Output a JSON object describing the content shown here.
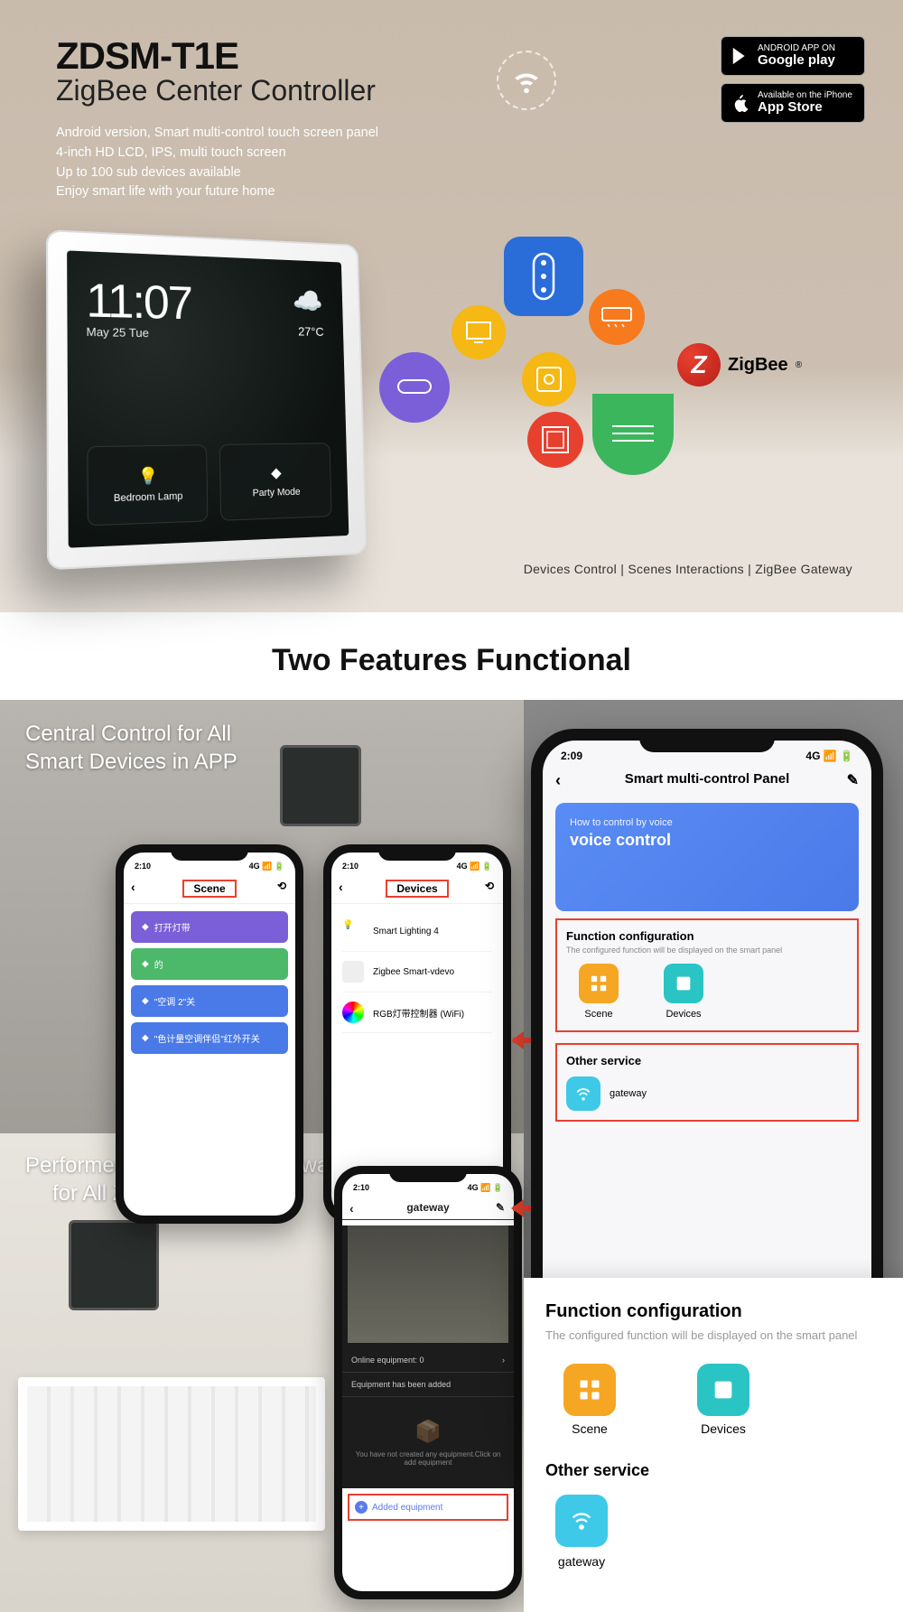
{
  "hero": {
    "model": "ZDSM-T1E",
    "title": "ZigBee Center Controller",
    "spec1": "Android version, Smart multi-control touch screen panel",
    "spec2": "4-inch HD LCD, IPS, multi touch screen",
    "spec3": "Up to 100 sub devices available",
    "spec4": "Enjoy smart life with your future home",
    "googleplay_top": "ANDROID APP ON",
    "googleplay": "Google play",
    "appstore_top": "Available on the iPhone",
    "appstore": "App Store",
    "tagline": "Devices Control  |  Scenes Interactions  |  ZigBee Gateway",
    "zigbee": "ZigBee"
  },
  "device": {
    "time": "11:07",
    "date": "May 25 Tue",
    "temp": "27°C",
    "tile1": "Bedroom Lamp",
    "tile2": "Party Mode"
  },
  "section_title": "Two Features Functional",
  "captions": {
    "c1a": "Central Control for All",
    "c1b": "Smart Devices in APP",
    "c2a": "Performed as a ZigBee Gateway",
    "c2b": "for All ZigBee Devices"
  },
  "status": {
    "time": "2:10",
    "net": "4G",
    "time2": "2:09"
  },
  "phone_scene": {
    "header": "Scene",
    "items": [
      "打开灯带",
      "的",
      "\"空调 2\"关",
      "\"色计量空调伴侣\"红外开关"
    ]
  },
  "phone_devices": {
    "header": "Devices",
    "items": [
      "Smart Lighting 4",
      "Zigbee Smart-vdevo",
      "RGB灯带控制器 (WiFi)"
    ]
  },
  "phone_gateway": {
    "header": "gateway",
    "online": "Online equipment: 0",
    "added_hdr": "Equipment has been added",
    "empty": "You have not created any equipment.Click on add equipment",
    "add_btn": "Added equipment"
  },
  "bigphone": {
    "title": "Smart multi-control Panel",
    "voice_sub": "How to control by voice",
    "voice_main": "voice control",
    "fc_title": "Function configuration",
    "fc_sub": "The configured function will be displayed on the smart panel",
    "scene": "Scene",
    "devices": "Devices",
    "other": "Other service",
    "gateway": "gateway"
  },
  "callout": {
    "title": "Function configuration",
    "sub": "The configured function will be displayed on the smart panel",
    "scene": "Scene",
    "devices": "Devices",
    "other": "Other service",
    "gateway": "gateway"
  }
}
